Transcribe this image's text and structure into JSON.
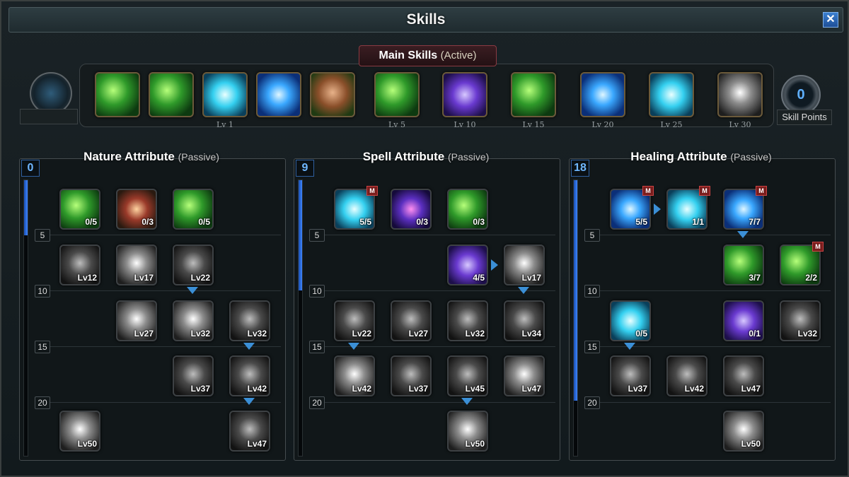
{
  "window": {
    "title": "Skills",
    "close_label": "✕"
  },
  "main_skills": {
    "header": "Main Skills",
    "header_sub": "(Active)",
    "slots": [
      {
        "level_label": "",
        "icon": "leaf-slash-icon",
        "look": "c-green"
      },
      {
        "level_label": "",
        "icon": "wind-slash-icon",
        "look": "c-green"
      },
      {
        "level_label": "Lv 1",
        "icon": "lightning-burst-icon",
        "look": "c-cyan"
      },
      {
        "level_label": "",
        "icon": "energy-orb-icon",
        "look": "c-blue"
      },
      {
        "level_label": "",
        "icon": "monk-face-icon",
        "look": "c-face"
      },
      {
        "level_label": "Lv 5",
        "icon": "leaf-storm-icon",
        "look": "c-green"
      },
      {
        "level_label": "Lv 10",
        "icon": "arcane-circle-icon",
        "look": "c-purple"
      },
      {
        "level_label": "Lv 15",
        "icon": "vine-whip-icon",
        "look": "c-green"
      },
      {
        "level_label": "Lv 20",
        "icon": "lightning-strike-icon",
        "look": "c-blue"
      },
      {
        "level_label": "Lv 25",
        "icon": "vortex-icon",
        "look": "c-cyan"
      },
      {
        "level_label": "Lv 30",
        "icon": "locked-skill-icon",
        "look": "c-grey"
      }
    ],
    "skill_points_value": "0",
    "skill_points_label": "Skill Points"
  },
  "tiers": [
    "5",
    "10",
    "15",
    "20"
  ],
  "panels": [
    {
      "title": "Nature Attribute",
      "title_sub": "(Passive)",
      "points": "0",
      "fill_fraction": 0.2,
      "skills": [
        {
          "value": "0/5",
          "icon": "wind-blade-icon",
          "look": "c-green",
          "m": false
        },
        {
          "value": "0/3",
          "icon": "fire-strike-icon",
          "look": "c-fire",
          "m": false
        },
        {
          "value": "0/5",
          "icon": "leaf-icon",
          "look": "c-green",
          "m": false
        },
        {
          "value": "Lv12",
          "icon": "locked-skill-icon",
          "look": "c-dark",
          "m": false
        },
        {
          "value": "Lv17",
          "icon": "locked-skill-icon",
          "look": "c-grey",
          "m": false
        },
        {
          "value": "Lv22",
          "icon": "locked-skill-icon",
          "look": "c-dark",
          "m": false
        },
        {
          "value": "Lv27",
          "icon": "eye-icon",
          "look": "c-grey",
          "m": false
        },
        {
          "value": "Lv32",
          "icon": "locked-skill-icon",
          "look": "c-grey",
          "m": false
        },
        {
          "value": "Lv32",
          "icon": "locked-skill-icon",
          "look": "c-dark",
          "m": false
        },
        {
          "value": "Lv37",
          "icon": "locked-skill-icon",
          "look": "c-dark",
          "m": false
        },
        {
          "value": "Lv42",
          "icon": "locked-skill-icon",
          "look": "c-dark",
          "m": false
        },
        {
          "value": "Lv50",
          "icon": "locked-skill-icon",
          "look": "c-grey",
          "m": false
        },
        {
          "value": "Lv47",
          "icon": "locked-skill-icon",
          "look": "c-dark",
          "m": false
        }
      ]
    },
    {
      "title": "Spell Attribute",
      "title_sub": "(Passive)",
      "points": "9",
      "fill_fraction": 0.4,
      "skills": [
        {
          "value": "5/5",
          "icon": "lightning-burst-icon",
          "look": "c-cyan",
          "m": true
        },
        {
          "value": "0/3",
          "icon": "star-shower-icon",
          "look": "c-stars",
          "m": false
        },
        {
          "value": "0/3",
          "icon": "bamboo-icon",
          "look": "c-green",
          "m": false
        },
        {
          "value": "4/5",
          "icon": "arcane-circle-icon",
          "look": "c-purple",
          "m": false
        },
        {
          "value": "Lv17",
          "icon": "locked-skill-icon",
          "look": "c-grey",
          "m": false
        },
        {
          "value": "Lv22",
          "icon": "locked-skill-icon",
          "look": "c-dark",
          "m": false
        },
        {
          "value": "Lv27",
          "icon": "locked-skill-icon",
          "look": "c-dark",
          "m": false
        },
        {
          "value": "Lv32",
          "icon": "locked-skill-icon",
          "look": "c-dark",
          "m": false
        },
        {
          "value": "Lv34",
          "icon": "locked-skill-icon",
          "look": "c-dark",
          "m": false
        },
        {
          "value": "Lv42",
          "icon": "locked-skill-icon",
          "look": "c-grey",
          "m": false
        },
        {
          "value": "Lv37",
          "icon": "locked-skill-icon",
          "look": "c-dark",
          "m": false
        },
        {
          "value": "Lv45",
          "icon": "locked-skill-icon",
          "look": "c-dark",
          "m": false
        },
        {
          "value": "Lv47",
          "icon": "locked-skill-icon",
          "look": "c-grey",
          "m": false
        },
        {
          "value": "Lv50",
          "icon": "locked-skill-icon",
          "look": "c-grey",
          "m": false
        }
      ]
    },
    {
      "title": "Healing Attribute",
      "title_sub": "(Passive)",
      "points": "18",
      "fill_fraction": 0.8,
      "skills": [
        {
          "value": "5/5",
          "icon": "energy-orb-icon",
          "look": "c-blue",
          "m": true
        },
        {
          "value": "1/1",
          "icon": "sparkle-icon",
          "look": "c-cyan",
          "m": true
        },
        {
          "value": "7/7",
          "icon": "water-orb-icon",
          "look": "c-blue",
          "m": true
        },
        {
          "value": "3/7",
          "icon": "nature-orb-icon",
          "look": "c-green",
          "m": false
        },
        {
          "value": "2/2",
          "icon": "vine-whip-icon",
          "look": "c-green",
          "m": true
        },
        {
          "value": "0/5",
          "icon": "frost-burst-icon",
          "look": "c-cyan",
          "m": false
        },
        {
          "value": "0/1",
          "icon": "wave-icon",
          "look": "c-purple",
          "m": false
        },
        {
          "value": "Lv32",
          "icon": "locked-skill-icon",
          "look": "c-dark",
          "m": false
        },
        {
          "value": "Lv37",
          "icon": "locked-skill-icon",
          "look": "c-dark",
          "m": false
        },
        {
          "value": "Lv42",
          "icon": "locked-skill-icon",
          "look": "c-dark",
          "m": false
        },
        {
          "value": "Lv47",
          "icon": "locked-skill-icon",
          "look": "c-dark",
          "m": false
        },
        {
          "value": "Lv50",
          "icon": "locked-skill-icon",
          "look": "c-grey",
          "m": false
        }
      ]
    }
  ]
}
